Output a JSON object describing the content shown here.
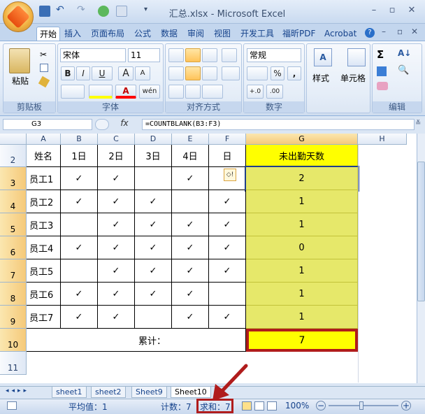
{
  "window": {
    "title": "汇总.xlsx - Microsoft Excel",
    "minimize": "–",
    "restore": "▫",
    "close": "✕"
  },
  "tabs": [
    "开始",
    "插入",
    "页面布局",
    "公式",
    "数据",
    "审阅",
    "视图",
    "开发工具",
    "福昕PDF",
    "Acrobat"
  ],
  "ribbon": {
    "paste_label": "粘贴",
    "font_name": "宋体",
    "font_size": "11",
    "bold": "B",
    "italic": "I",
    "underline": "U",
    "grow": "A",
    "shrink": "A",
    "phonetic": "wén",
    "number_format": "常规",
    "percent": "%",
    "comma": ",",
    "inc_decimal": "+.0",
    "dec_decimal": ".00",
    "styles_label": "样式",
    "cells_label": "单元格",
    "sum_symbol": "Σ",
    "groups": {
      "clipboard": "剪贴板",
      "font": "字体",
      "alignment": "对齐方式",
      "number": "数字",
      "editing": "编辑"
    }
  },
  "formula_bar": {
    "name_box": "G3",
    "fx": "fx",
    "formula": "=COUNTBLANK(B3:F3)"
  },
  "sheet": {
    "columns": [
      "A",
      "B",
      "C",
      "D",
      "E",
      "F",
      "G",
      "H"
    ],
    "rows": [
      "2",
      "3",
      "4",
      "5",
      "6",
      "7",
      "8",
      "9",
      "10",
      "11"
    ],
    "header_row": [
      "姓名",
      "1日",
      "2日",
      "3日",
      "4日",
      "日",
      "未出勤天数"
    ],
    "data": [
      {
        "name": "员工1",
        "marks": [
          "✓",
          "✓",
          "",
          "✓",
          ""
        ],
        "count": "2"
      },
      {
        "name": "员工2",
        "marks": [
          "✓",
          "✓",
          "✓",
          "",
          "✓"
        ],
        "count": "1"
      },
      {
        "name": "员工3",
        "marks": [
          "",
          "✓",
          "✓",
          "✓",
          "✓"
        ],
        "count": "1"
      },
      {
        "name": "员工4",
        "marks": [
          "✓",
          "✓",
          "✓",
          "✓",
          "✓"
        ],
        "count": "0"
      },
      {
        "name": "员工5",
        "marks": [
          "",
          "✓",
          "✓",
          "✓",
          "✓"
        ],
        "count": "1"
      },
      {
        "name": "员工6",
        "marks": [
          "✓",
          "✓",
          "✓",
          "✓",
          ""
        ],
        "count": "1"
      },
      {
        "name": "员工7",
        "marks": [
          "✓",
          "✓",
          "",
          "✓",
          "✓"
        ],
        "count": "1"
      }
    ],
    "total_label": "累计：",
    "total_value": "7",
    "error_icon": "◇!"
  },
  "sheet_tabs": [
    "sheet1",
    "sheet2",
    "Sheet9",
    "Sheet10"
  ],
  "status": {
    "average": "平均值：1",
    "count": "计数：7",
    "sum": "求和：7",
    "zoom": "100%"
  },
  "colors": {
    "highlight_yellow": "#ffff00",
    "cell_yellow": "#e6e86a",
    "annotation_red": "#b01c1c"
  }
}
